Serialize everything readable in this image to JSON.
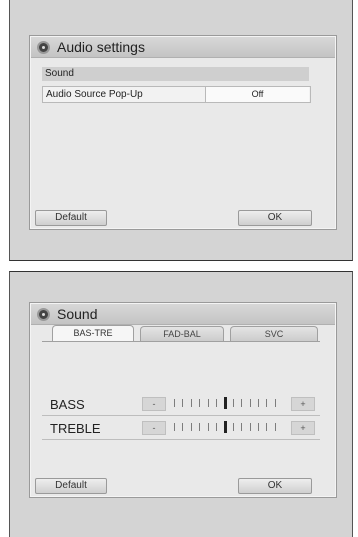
{
  "audio_settings": {
    "title": "Audio settings",
    "section_header": "Sound",
    "items": [
      {
        "label": "Audio Source Pop-Up",
        "value": "Off"
      }
    ],
    "default_label": "Default",
    "ok_label": "OK"
  },
  "sound": {
    "title": "Sound",
    "tabs": [
      {
        "label": "BAS-TRE",
        "active": true
      },
      {
        "label": "FAD-BAL",
        "active": false
      },
      {
        "label": "SVC",
        "active": false
      }
    ],
    "sliders": [
      {
        "label": "BASS",
        "minus": "-",
        "plus": "+",
        "level": 0
      },
      {
        "label": "TREBLE",
        "minus": "-",
        "plus": "+",
        "level": 0
      }
    ],
    "default_label": "Default",
    "ok_label": "OK"
  },
  "icons": {
    "title_icon": "settings-knob-icon"
  }
}
